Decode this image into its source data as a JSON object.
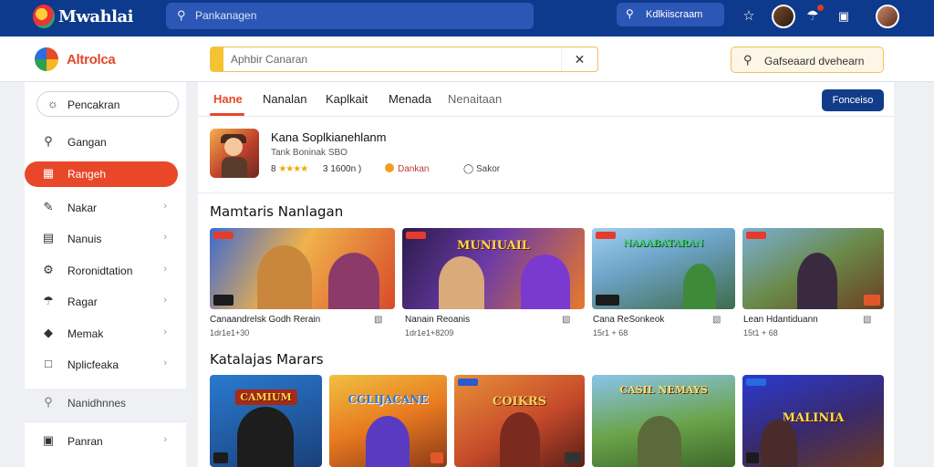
{
  "topbar": {
    "brand": "Mwahlai",
    "search_placeholder": "Pankanagen",
    "action_label": "Kdlkiiscraam",
    "icons": [
      "star-icon",
      "avatar-icon",
      "bag-icon",
      "chat-icon",
      "avatar-icon"
    ]
  },
  "header": {
    "brand": "Altrolca",
    "search_placeholder": "Aphbir Canaran",
    "button_label": "Gafseaard dvehearn"
  },
  "sidebar": {
    "items": [
      {
        "label": "Pencakran",
        "icon": "compass-icon"
      },
      {
        "label": "Gangan",
        "icon": "search-icon"
      },
      {
        "label": "Rangeh",
        "icon": "grid-icon"
      },
      {
        "label": "Nakar",
        "icon": "pen-icon"
      },
      {
        "label": "Nanuis",
        "icon": "list-icon"
      },
      {
        "label": "Roronidtation",
        "icon": "settings-icon"
      },
      {
        "label": "Ragar",
        "icon": "bag-icon"
      },
      {
        "label": "Memak",
        "icon": "tag-icon"
      },
      {
        "label": "Nplicfeaka",
        "icon": "doc-icon"
      }
    ],
    "extra_label": "Nanidhnnes",
    "footer_label": "Panran"
  },
  "tabs": [
    "Hane",
    "Nanalan",
    "Kaplkait",
    "Menada",
    "Nenaitaan"
  ],
  "tab_button": "Fonceiso",
  "featured": {
    "title": "Kana Soplkianehlanm",
    "subtitle": "Tank Boninak SBO",
    "rating": "8",
    "stars": "★★★★",
    "downloads": "3 1600n )",
    "badge1": "Dankan",
    "badge2": "Sakor"
  },
  "section1": {
    "title": "Mamtaris  Nanlagan",
    "cards": [
      {
        "name": "Canaandrelsk Godh Rerain",
        "meta": "1dr1e1+30",
        "banner": ""
      },
      {
        "name": "Nanain Reoanis",
        "meta": "1dr1e1+8209",
        "banner": "MUNIUAIL"
      },
      {
        "name": "Cana ReSonkeok",
        "meta": "15r1 + 68",
        "banner": "NAAABATARAN"
      },
      {
        "name": "Lean Hdantiduann",
        "meta": "15t1 + 68",
        "banner": ""
      }
    ]
  },
  "section2": {
    "title": "Katalajas  Marars",
    "cards": [
      {
        "banner": "CAMIUM"
      },
      {
        "banner": "CGLIJACANE"
      },
      {
        "banner": "COIKRS"
      },
      {
        "banner": "CASIL NEMAYS"
      },
      {
        "banner": "MALINIA"
      }
    ]
  },
  "colors": {
    "topbar": "#0d3a8c",
    "accent": "#e8472a",
    "button_blue": "#123c8a",
    "search_accent": "#f5c230"
  }
}
